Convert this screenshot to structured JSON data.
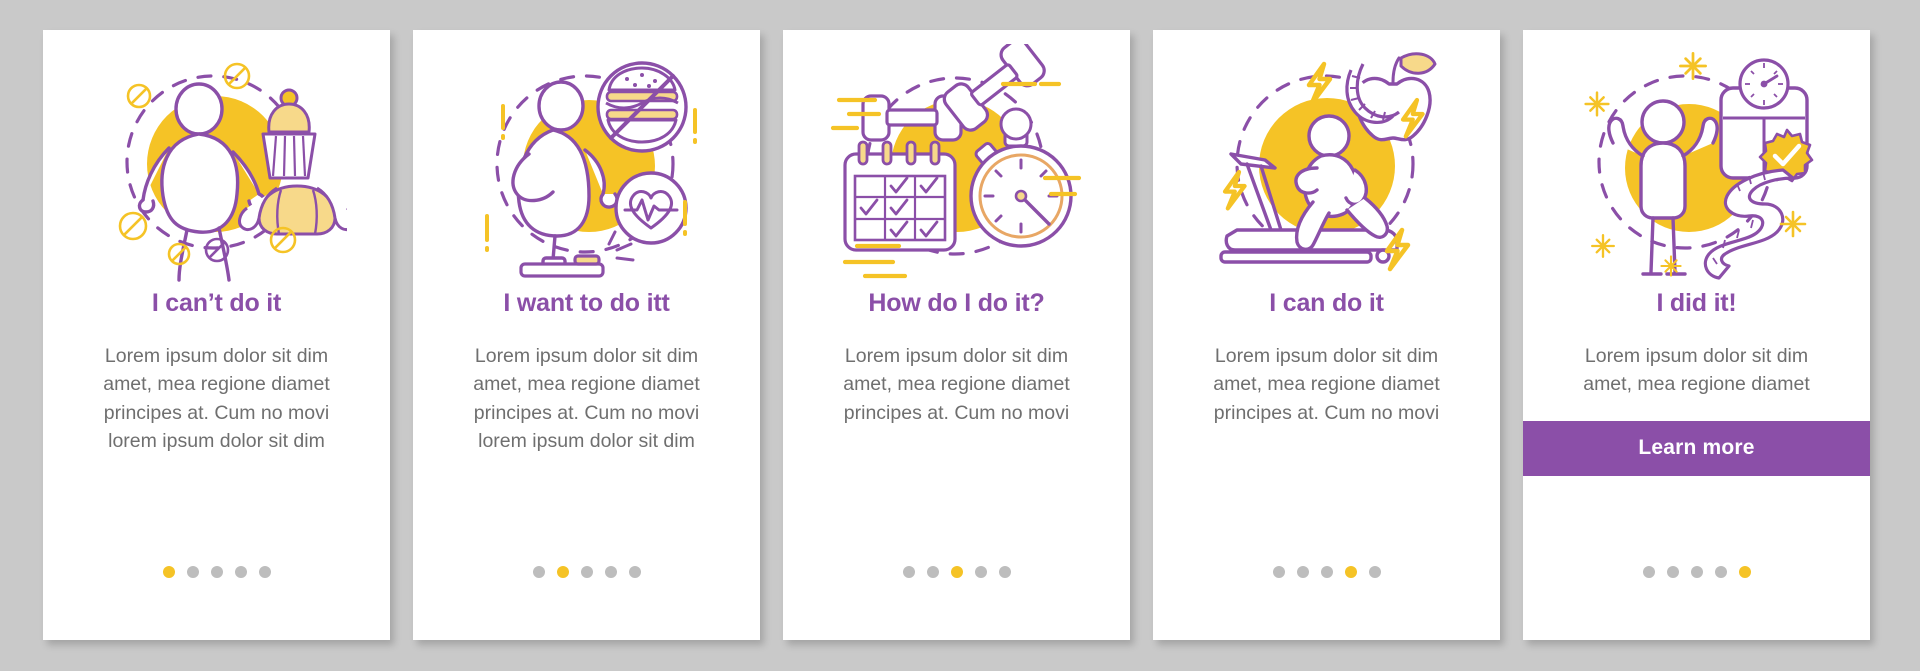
{
  "page": {
    "background_color": "#c9c9c9",
    "card_background": "#ffffff",
    "accent_purple": "#8B4FA8",
    "accent_yellow": "#F5C326",
    "body_text_color": "#6f6f6f",
    "dot_inactive_color": "#bdbdbd",
    "total_steps": 5
  },
  "cards": [
    {
      "illustration_name": "overweight-person-sweets-illustration",
      "title": "I can’t do it",
      "body_lines": [
        "Lorem ipsum dolor sit dim",
        "amet, mea regione diamet",
        "principes at. Cum no movi",
        "lorem ipsum dolor sit dim"
      ],
      "active_dot": 1,
      "cta_label": null
    },
    {
      "illustration_name": "person-on-scale-no-fastfood-illustration",
      "title": "I want to do itt",
      "body_lines": [
        "Lorem ipsum dolor sit dim",
        "amet, mea regione diamet",
        "principes at. Cum no movi",
        "lorem ipsum dolor sit dim"
      ],
      "active_dot": 2,
      "cta_label": null
    },
    {
      "illustration_name": "dumbbell-calendar-stopwatch-illustration",
      "title": "How do I do it?",
      "body_lines": [
        "Lorem ipsum dolor sit dim",
        "amet, mea regione diamet",
        "principes at. Cum no movi"
      ],
      "active_dot": 3,
      "cta_label": null
    },
    {
      "illustration_name": "treadmill-runner-apple-tape-illustration",
      "title": "I can do it",
      "body_lines": [
        "Lorem ipsum dolor sit dim",
        "amet, mea regione diamet",
        "principes at. Cum no movi"
      ],
      "active_dot": 4,
      "cta_label": null
    },
    {
      "illustration_name": "celebrating-person-scale-tape-illustration",
      "title": "I did it!",
      "body_lines": [
        "Lorem ipsum dolor sit dim",
        "amet, mea regione diamet"
      ],
      "active_dot": 5,
      "cta_label": "Learn more"
    }
  ]
}
